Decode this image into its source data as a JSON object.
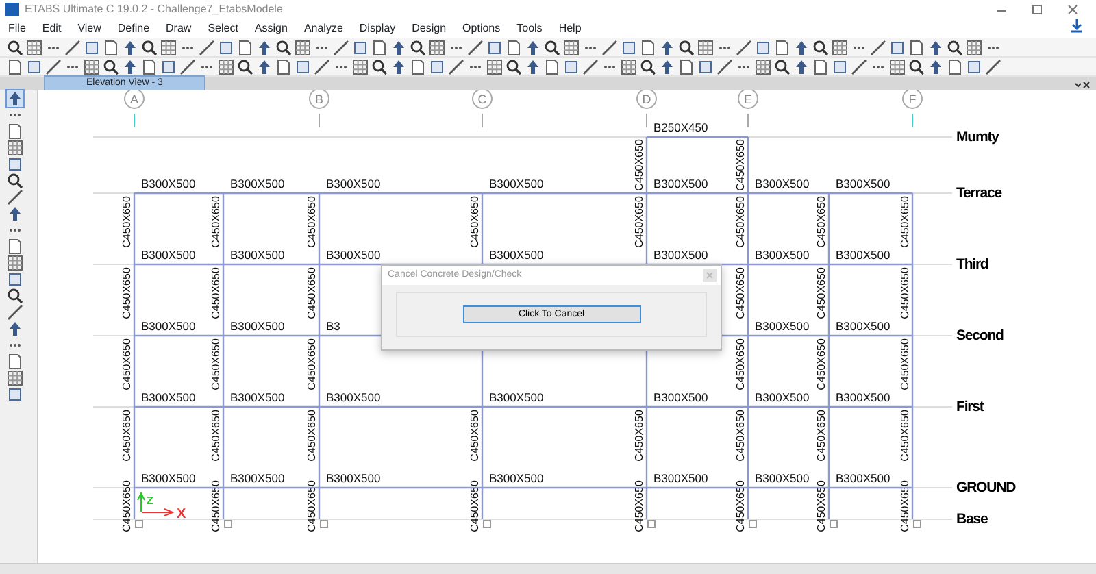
{
  "window": {
    "title": "ETABS Ultimate C 19.0.2 - Challenge7_EtabsModele"
  },
  "menu": [
    "File",
    "Edit",
    "View",
    "Define",
    "Draw",
    "Select",
    "Assign",
    "Analyze",
    "Display",
    "Design",
    "Options",
    "Tools",
    "Help"
  ],
  "view_tab": {
    "label": "Elevation View - 3",
    "selected": true
  },
  "elevation": {
    "grid_bubbles": [
      "A",
      "B",
      "C",
      "D",
      "E",
      "F"
    ],
    "stories": [
      {
        "name": "Mumty",
        "beams": [
          {
            "kind": "none"
          },
          {
            "kind": "none"
          },
          {
            "kind": "none"
          },
          {
            "kind": "none"
          },
          {
            "kind": "beam",
            "label": "B250X450"
          },
          {
            "kind": "none"
          },
          {
            "kind": "none"
          }
        ],
        "columns": [
          {
            "kind": "none"
          },
          {
            "kind": "none"
          },
          {
            "kind": "none"
          },
          {
            "kind": "none"
          },
          {
            "kind": "column",
            "label": "C450X650"
          },
          {
            "kind": "column",
            "label": "C450X650"
          },
          {
            "kind": "none"
          },
          {
            "kind": "none"
          }
        ]
      },
      {
        "name": "Terrace",
        "beams": [
          {
            "kind": "beam",
            "label": "B300X500"
          },
          {
            "kind": "beam",
            "label": "B300X500"
          },
          {
            "kind": "beam",
            "label": "B300X500"
          },
          {
            "kind": "beam",
            "label": "B300X500"
          },
          {
            "kind": "beam",
            "label": "B300X500"
          },
          {
            "kind": "beam",
            "label": "B300X500"
          },
          {
            "kind": "beam",
            "label": "B300X500"
          }
        ],
        "columns": [
          {
            "kind": "column",
            "label": "C450X650"
          },
          {
            "kind": "column",
            "label": "C450X650"
          },
          {
            "kind": "column",
            "label": "C450X650"
          },
          {
            "kind": "column",
            "label": "C450X650"
          },
          {
            "kind": "column",
            "label": "C450X650"
          },
          {
            "kind": "column",
            "label": "C450X650"
          },
          {
            "kind": "column",
            "label": "C450X650"
          },
          {
            "kind": "column",
            "label": "C450X650"
          }
        ]
      },
      {
        "name": "Third",
        "beams": [
          {
            "kind": "beam",
            "label": "B300X500"
          },
          {
            "kind": "beam",
            "label": "B300X500"
          },
          {
            "kind": "beam",
            "label": "B300X500"
          },
          {
            "kind": "beam",
            "label": "B300X500"
          },
          {
            "kind": "beam",
            "label": "B300X500"
          },
          {
            "kind": "beam",
            "label": "B300X500"
          },
          {
            "kind": "beam",
            "label": "B300X500"
          }
        ],
        "columns": [
          {
            "kind": "column",
            "label": "C450X650"
          },
          {
            "kind": "column",
            "label": "C450X650"
          },
          {
            "kind": "column",
            "label": "C450X650"
          },
          {
            "kind": "column"
          },
          {
            "kind": "column"
          },
          {
            "kind": "column",
            "label": "C450X650"
          },
          {
            "kind": "column",
            "label": "C450X650"
          },
          {
            "kind": "column",
            "label": "C450X650"
          }
        ]
      },
      {
        "name": "Second",
        "beams": [
          {
            "kind": "beam",
            "label": "B300X500"
          },
          {
            "kind": "beam",
            "label": "B300X500"
          },
          {
            "kind": "beam",
            "label": "B3"
          },
          {
            "kind": "beam"
          },
          {
            "kind": "beam"
          },
          {
            "kind": "beam",
            "label": "B300X500"
          },
          {
            "kind": "beam",
            "label": "B300X500"
          }
        ],
        "columns": [
          {
            "kind": "column",
            "label": "C450X650"
          },
          {
            "kind": "column",
            "label": "C450X650"
          },
          {
            "kind": "column",
            "label": "C450X650"
          },
          {
            "kind": "column"
          },
          {
            "kind": "column"
          },
          {
            "kind": "column",
            "label": "C450X650"
          },
          {
            "kind": "column",
            "label": "C450X650"
          },
          {
            "kind": "column",
            "label": "C450X650"
          }
        ]
      },
      {
        "name": "First",
        "beams": [
          {
            "kind": "beam",
            "label": "B300X500"
          },
          {
            "kind": "beam",
            "label": "B300X500"
          },
          {
            "kind": "beam",
            "label": "B300X500"
          },
          {
            "kind": "beam",
            "label": "B300X500"
          },
          {
            "kind": "beam",
            "label": "B300X500"
          },
          {
            "kind": "beam",
            "label": "B300X500"
          },
          {
            "kind": "beam",
            "label": "B300X500"
          }
        ],
        "columns": [
          {
            "kind": "column",
            "label": "C450X650"
          },
          {
            "kind": "column",
            "label": "C450X650"
          },
          {
            "kind": "column",
            "label": "C450X650"
          },
          {
            "kind": "column",
            "label": "C450X650"
          },
          {
            "kind": "column",
            "label": "C450X650"
          },
          {
            "kind": "column",
            "label": "C450X650"
          },
          {
            "kind": "column",
            "label": "C450X650"
          },
          {
            "kind": "column",
            "label": "C450X650"
          }
        ]
      },
      {
        "name": "GROUND",
        "beams": [
          {
            "kind": "beam",
            "label": "B300X500"
          },
          {
            "kind": "beam",
            "label": "B300X500"
          },
          {
            "kind": "beam",
            "label": "B300X500"
          },
          {
            "kind": "beam",
            "label": "B300X500"
          },
          {
            "kind": "beam",
            "label": "B300X500"
          },
          {
            "kind": "beam",
            "label": "B300X500"
          },
          {
            "kind": "beam",
            "label": "B300X500"
          }
        ],
        "columns": [
          {
            "kind": "column",
            "label": "C450X650"
          },
          {
            "kind": "column",
            "label": "C450X650"
          },
          {
            "kind": "column",
            "label": "C450X650"
          },
          {
            "kind": "column",
            "label": "C450X650"
          },
          {
            "kind": "column",
            "label": "C450X650"
          },
          {
            "kind": "column",
            "label": "C450X650"
          },
          {
            "kind": "column",
            "label": "C450X650"
          },
          {
            "kind": "column",
            "label": "C450X650"
          }
        ]
      },
      {
        "name": "Base"
      }
    ],
    "axes": {
      "x_label": "X",
      "z_label": "Z"
    }
  },
  "dialog": {
    "title": "Cancel Concrete Design/Check",
    "button": "Click To Cancel"
  }
}
